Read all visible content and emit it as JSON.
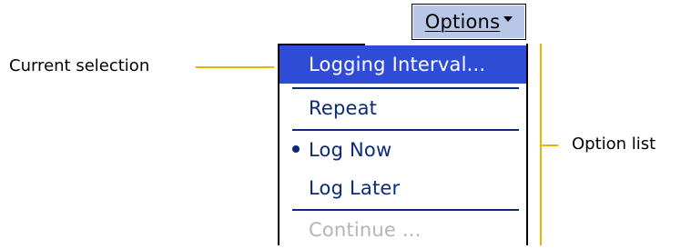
{
  "menu_button": {
    "label": "Options"
  },
  "menu": {
    "items": [
      {
        "label": "Logging Interval...",
        "state": "selected"
      },
      {
        "label": "Repeat",
        "state": "normal"
      },
      {
        "label": "Log Now",
        "state": "checked"
      },
      {
        "label": "Log Later",
        "state": "normal"
      },
      {
        "label": "Continue ...",
        "state": "disabled"
      }
    ]
  },
  "annotations": {
    "current_selection": "Current selection",
    "option_list": "Option list"
  },
  "colors": {
    "selection_highlight": "#2f4cd6",
    "menu_text": "#0b2a78",
    "disabled_text": "#b5b5b5",
    "button_background": "#b8c7e7",
    "callout_line": "#e7b400"
  }
}
